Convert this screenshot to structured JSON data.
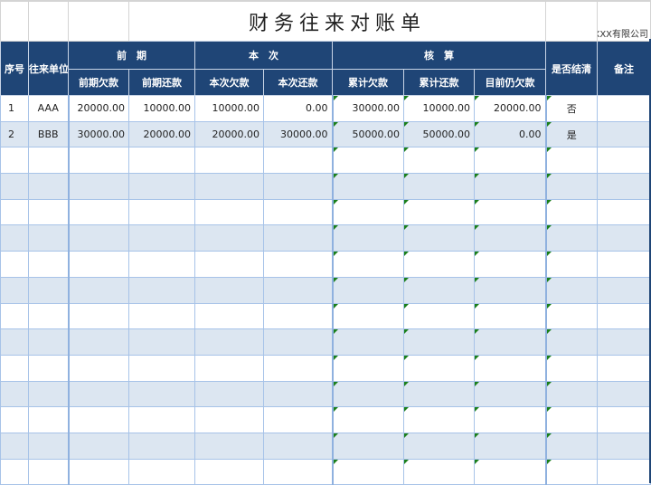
{
  "title": "财务往来对账单",
  "company": "XXX有限公司",
  "headers": {
    "seq": "序号",
    "unit": "往来单位",
    "group_prev": "前　期",
    "group_curr": "本　次",
    "group_check": "核　算",
    "settled": "是否结清",
    "remark": "备注",
    "prev_owed": "前期欠款",
    "prev_repaid": "前期还款",
    "curr_owed": "本次欠款",
    "curr_repaid": "本次还款",
    "total_owed": "累计欠款",
    "total_repaid": "累计还款",
    "still_owed": "目前仍欠款"
  },
  "rows": [
    [
      "1",
      "AAA",
      "20000.00",
      "10000.00",
      "10000.00",
      "0.00",
      "30000.00",
      "10000.00",
      "20000.00",
      "否",
      ""
    ],
    [
      "2",
      "BBB",
      "30000.00",
      "20000.00",
      "20000.00",
      "30000.00",
      "50000.00",
      "50000.00",
      "0.00",
      "是",
      ""
    ],
    [
      "",
      "",
      "",
      "",
      "",
      "",
      "",
      "",
      "",
      "",
      ""
    ],
    [
      "",
      "",
      "",
      "",
      "",
      "",
      "",
      "",
      "",
      "",
      ""
    ],
    [
      "",
      "",
      "",
      "",
      "",
      "",
      "",
      "",
      "",
      "",
      ""
    ],
    [
      "",
      "",
      "",
      "",
      "",
      "",
      "",
      "",
      "",
      "",
      ""
    ],
    [
      "",
      "",
      "",
      "",
      "",
      "",
      "",
      "",
      "",
      "",
      ""
    ],
    [
      "",
      "",
      "",
      "",
      "",
      "",
      "",
      "",
      "",
      "",
      ""
    ],
    [
      "",
      "",
      "",
      "",
      "",
      "",
      "",
      "",
      "",
      "",
      ""
    ],
    [
      "",
      "",
      "",
      "",
      "",
      "",
      "",
      "",
      "",
      "",
      ""
    ],
    [
      "",
      "",
      "",
      "",
      "",
      "",
      "",
      "",
      "",
      "",
      ""
    ],
    [
      "",
      "",
      "",
      "",
      "",
      "",
      "",
      "",
      "",
      "",
      ""
    ],
    [
      "",
      "",
      "",
      "",
      "",
      "",
      "",
      "",
      "",
      "",
      ""
    ],
    [
      "",
      "",
      "",
      "",
      "",
      "",
      "",
      "",
      "",
      "",
      ""
    ],
    [
      "",
      "",
      "",
      "",
      "",
      "",
      "",
      "",
      "",
      "",
      ""
    ]
  ],
  "colors": {
    "header_bg": "#1f4576",
    "alt_row": "#dce6f1",
    "grid": "#a7c3e8",
    "marker": "#1a7f1a"
  }
}
